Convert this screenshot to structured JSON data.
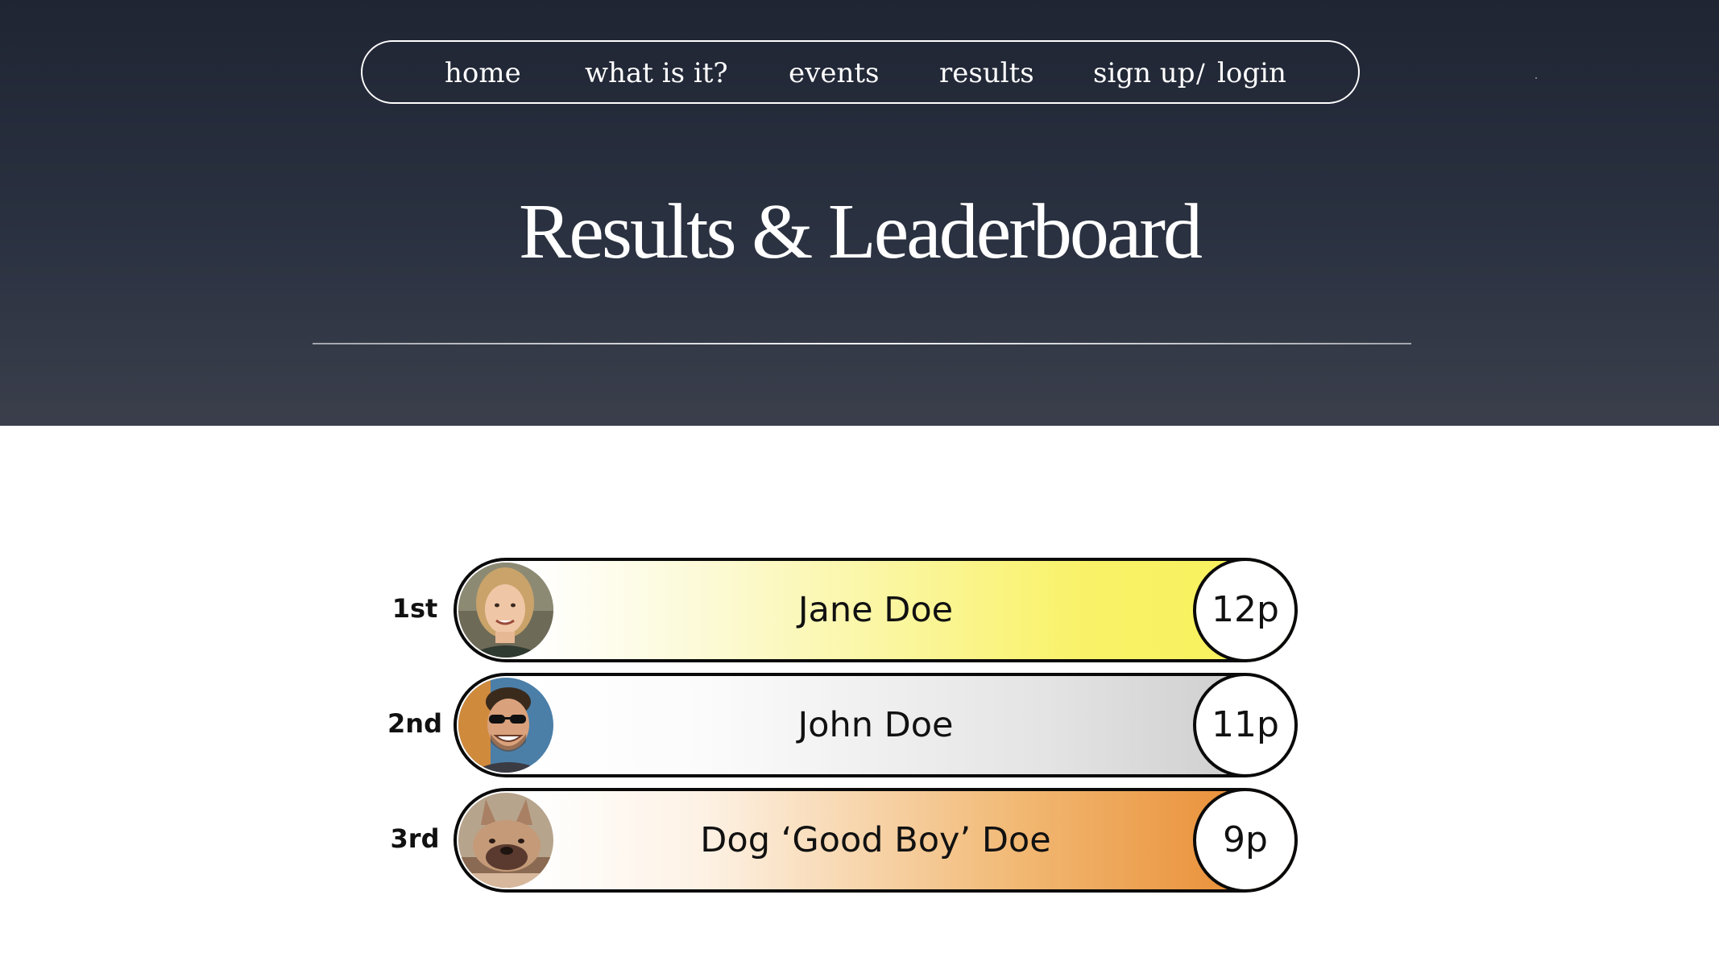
{
  "nav": {
    "home": "home",
    "what_is_it": "what is it?",
    "events": "events",
    "results": "results",
    "sign_up": "sign up",
    "separator": "/",
    "login": "login"
  },
  "hero": {
    "title": "Results & Leaderboard"
  },
  "leaderboard": [
    {
      "rank": "1st",
      "name": "Jane Doe",
      "score": "12p",
      "tier": "gold",
      "avatar": "woman-portrait-photo"
    },
    {
      "rank": "2nd",
      "name": "John Doe",
      "score": "11p",
      "tier": "silver",
      "avatar": "man-sunglasses-photo"
    },
    {
      "rank": "3rd",
      "name": "Dog ‘Good Boy’ Doe",
      "score": "9p",
      "tier": "bronze",
      "avatar": "french-bulldog-photo"
    }
  ],
  "colors": {
    "hero_bg": "#1f2533",
    "gold": "#f8f15a",
    "silver": "#c9c9c9",
    "bronze": "#e8862a"
  }
}
